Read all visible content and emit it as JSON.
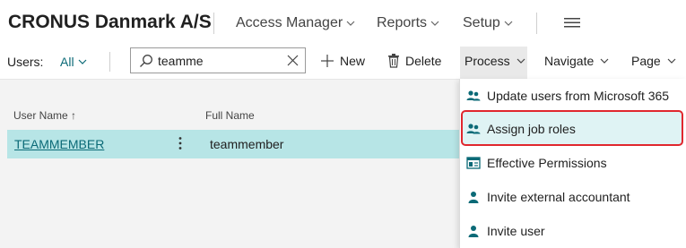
{
  "topbar": {
    "company": "CRONUS Danmark A/S",
    "nav": [
      "Access Manager",
      "Reports",
      "Setup"
    ]
  },
  "actionbar": {
    "users_label": "Users:",
    "filter": "All",
    "search_value": "teamme",
    "new_label": "New",
    "delete_label": "Delete",
    "process_label": "Process",
    "navigate_label": "Navigate",
    "page_label": "Page"
  },
  "table": {
    "col_user_name": "User Name",
    "col_user_name_sort": "↑",
    "col_full_name": "Full Name",
    "rows": [
      {
        "user_name": "TEAMMEMBER",
        "full_name": "teammember"
      }
    ]
  },
  "process_menu": {
    "items": [
      {
        "label": "Update users from Microsoft 365",
        "icon": "users-icon"
      },
      {
        "label": "Assign job roles",
        "icon": "users-icon"
      },
      {
        "label": "Effective Permissions",
        "icon": "permissions-icon"
      },
      {
        "label": "Invite external accountant",
        "icon": "user-icon"
      },
      {
        "label": "Invite user",
        "icon": "user-icon"
      }
    ],
    "highlighted_index": 1
  },
  "colors": {
    "accent": "#0b6a77",
    "row_selected": "#b7e5e6",
    "highlight_border": "#e0272e"
  }
}
